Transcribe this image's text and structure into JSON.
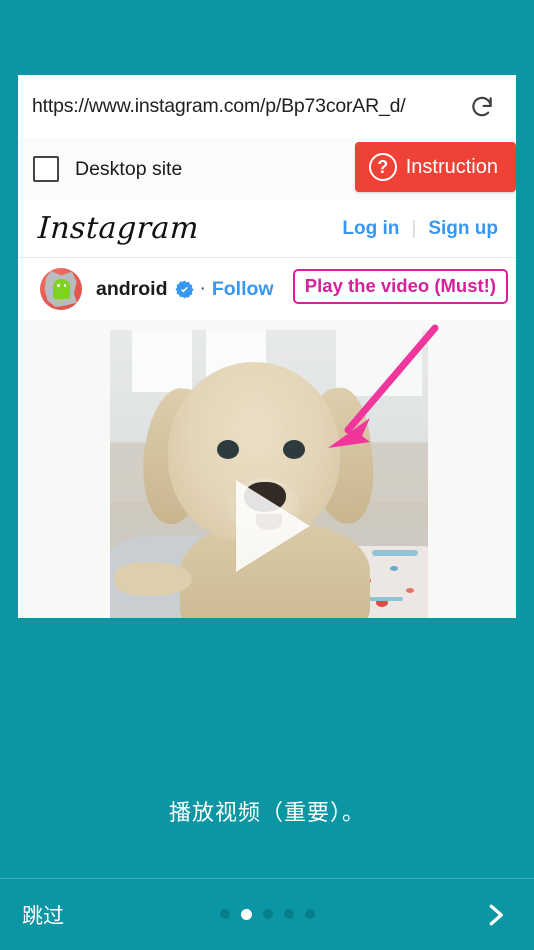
{
  "theme": {
    "background": "#0a96a3",
    "accent_red": "#ef4136",
    "accent_blue": "#3897f0",
    "annotation_magenta": "#d6219c",
    "arrow_pink": "#f0359c"
  },
  "browser": {
    "url": "https://www.instagram.com/p/Bp73corAR_d/",
    "reload_icon": "reload-icon",
    "desktop_site_label": "Desktop site",
    "desktop_site_checked": false,
    "instruction_button": {
      "label": "Instruction",
      "icon": "question-circle-icon"
    }
  },
  "instagram": {
    "logo_text": "Instagram",
    "login_label": "Log in",
    "separator": "|",
    "signup_label": "Sign up",
    "account": {
      "username": "android",
      "verified_icon": "verified-badge-icon",
      "separator": "·",
      "follow_label": "Follow",
      "avatar_icon": "android-avatar-icon"
    },
    "post": {
      "media_type": "video",
      "play_icon": "play-triangle-icon",
      "image_description": "golden doodle puppy lying on a blanket"
    }
  },
  "annotation": {
    "badge_text": "Play the video (Must!)",
    "arrow_icon": "pointer-arrow-icon"
  },
  "caption": {
    "text": "播放视频（重要）。"
  },
  "bottom_bar": {
    "skip_label": "跳过",
    "next_icon": "chevron-right-icon",
    "pager": {
      "total": 5,
      "active_index": 1
    }
  }
}
